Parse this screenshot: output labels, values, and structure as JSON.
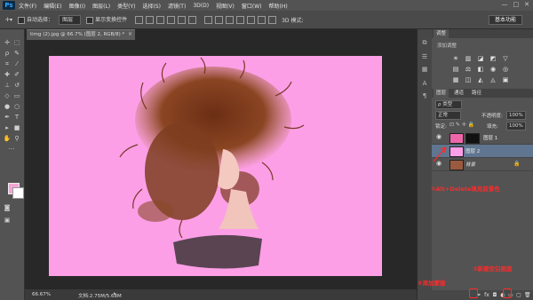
{
  "app": {
    "logo": "Ps",
    "window_controls": [
      "—",
      "□",
      "✕"
    ]
  },
  "menu": [
    "文件(F)",
    "编辑(E)",
    "图像(I)",
    "图层(L)",
    "类型(Y)",
    "选择(S)",
    "滤镜(T)",
    "3D(D)",
    "视图(V)",
    "窗口(W)",
    "帮助(H)"
  ],
  "options": {
    "auto_select_label": "自动选择：",
    "auto_select_value": "图层",
    "show_transform_label": "显示变换控件",
    "workspace": "基本功能"
  },
  "document": {
    "tab_title": "timg (2).jpg @ 66.7% (图层 2, RGB/8) *",
    "zoom": "66.67%",
    "doc_size": "文档:2.75M/5.68M"
  },
  "colors": {
    "foreground": "#f2a6d5",
    "background": "#ffffff",
    "canvas": "#fd9fe7",
    "annotation": "#ff2a2a"
  },
  "panels": {
    "adjust_tab": "调整",
    "adjust_sub": "添加调整",
    "adjust_icons": [
      "brightness-icon",
      "levels-icon",
      "curves-icon",
      "exposure-icon",
      "vibrance-icon",
      "hue-icon",
      "color-balance-icon",
      "bw-icon",
      "photo-filter-icon",
      "channel-mixer-icon",
      "lookup-icon",
      "invert-icon",
      "posterize-icon",
      "threshold-icon",
      "selective-color-icon",
      "gradient-map-icon"
    ],
    "layer_tabs": [
      "图层",
      "通道",
      "路径"
    ],
    "filter_kind": "ρ 类型",
    "blend_mode": "正常",
    "opacity_label": "不透明度:",
    "opacity_value": "100%",
    "lock_label": "锁定:",
    "fill_label": "填充:",
    "fill_value": "100%",
    "layers": [
      {
        "name": "图层 1"
      },
      {
        "name": "图层 2"
      },
      {
        "name": "背景"
      }
    ]
  },
  "annotations": {
    "fill_note": "①Alt+Delete填充前景色",
    "mask_note": "②添加蒙版",
    "new_layer_note": "③新建空白图层"
  }
}
